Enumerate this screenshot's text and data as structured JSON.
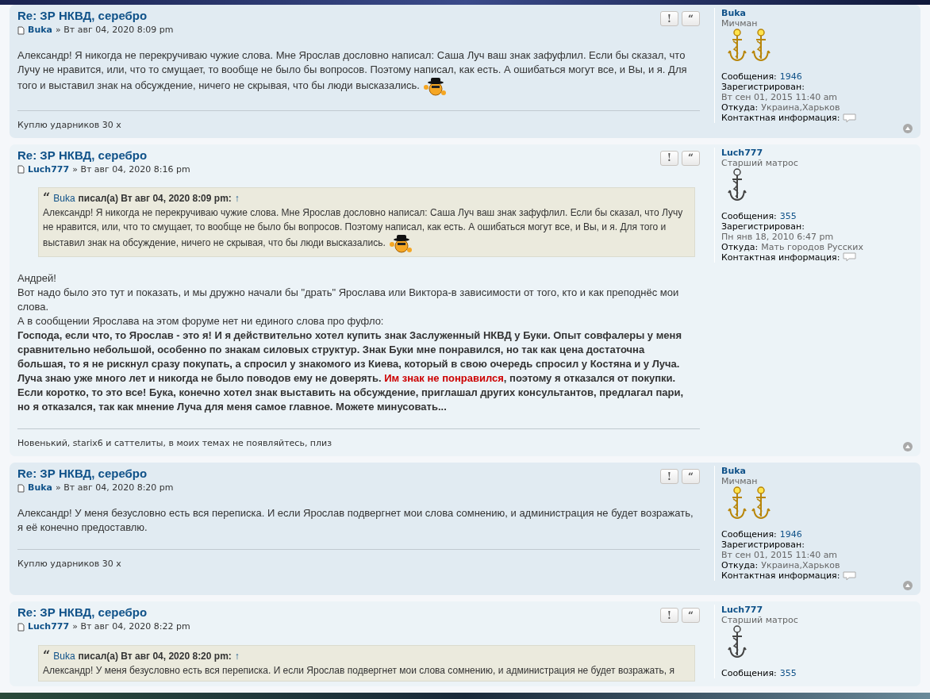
{
  "posts": [
    {
      "title": "Re: ЗР НКВД, серебро",
      "author": "Buka",
      "separator": "»",
      "date": "Вт авг 04, 2020 8:09 pm",
      "buttons": [
        "!",
        "“"
      ],
      "body": [
        {
          "kind": "text",
          "segments": [
            {
              "text": "Александр! Я никогда не перекручиваю чужие слова. Мне Ярослав дословно написал: Саша Луч ваш знак зафуфлил. Если бы сказал, что Лучу не нравится, или, что то смущает, то вообще не было бы вопросов. Поэтому написал, как есть. А ошибаться могут все, и Вы, и я. Для того и выставил знак на обсуждение, ничего не скрывая, что бы люди высказались.",
              "red": false
            }
          ],
          "smiley": true
        }
      ],
      "signature": "Куплю ударников 30 х",
      "profile": {
        "name": "Buka",
        "rank": "Мичман",
        "kind": "gold",
        "fields": [
          {
            "label": "Сообщения:",
            "value": "1946",
            "kind": "link"
          },
          {
            "label": "Зарегистрирован:",
            "value": "Вт сен 01, 2015 11:40 am",
            "kind": "plain"
          },
          {
            "label": "Откуда:",
            "value": "Украина,Харьков",
            "kind": "plain"
          },
          {
            "label": "Контактная информация:",
            "kind": "contact"
          }
        ]
      },
      "top_link": true
    },
    {
      "title": "Re: ЗР НКВД, серебро",
      "author": "Luch777",
      "separator": "»",
      "date": "Вт авг 04, 2020 8:16 pm",
      "buttons": [
        "!",
        "“"
      ],
      "quote": {
        "mark": "“",
        "author": "Buka",
        "meta": "писал(а) Вт авг 04, 2020 8:09 pm:",
        "arrow": "↑",
        "text": "Александр! Я никогда не перекручиваю чужие слова. Мне Ярослав дословно написал: Саша Луч ваш знак зафуфлил. Если бы сказал, что Лучу не нравится, или, что то смущает, то вообще не было бы вопросов. Поэтому написал, как есть. А ошибаться могут все, и Вы, и я. Для того и выставил знак на обсуждение, ничего не скрывая, что бы люди высказались.",
        "smiley": true
      },
      "body": [
        {
          "kind": "text",
          "segments": [
            {
              "text": "Андрей!",
              "red": false
            }
          ],
          "smiley": false
        },
        {
          "kind": "text",
          "segments": [
            {
              "text": "Вот надо было это тут и показать, и мы дружно начали бы \"драть\" Ярослава или Виктора-в зависимости от того, кто и как преподнёс мои слова.",
              "red": false
            }
          ],
          "smiley": false
        },
        {
          "kind": "text",
          "segments": [
            {
              "text": "А в сообщении Ярослава на этом форуме нет ни единого слова про фуфло:",
              "red": false
            }
          ],
          "smiley": false
        },
        {
          "kind": "bold",
          "segments": [
            {
              "text": "Господа, если что, то Ярослав - это я! И я действительно хотел купить знак Заслуженный НКВД у Буки. Опыт совфалеры у меня сравнительно небольшой, особенно по знакам силовых структур. Знак Буки мне понравился, но так как цена достаточна большая, то я не рискнул сразу покупать, а спросил у знакомого из Киева, который в свою очередь спросил у Костяна и у Луча. Луча знаю уже много лет и никогда не было поводов ему не доверять. ",
              "red": false
            },
            {
              "text": "Им знак не понравился",
              "red": true
            },
            {
              "text": ", поэтому я отказался от покупки. Если коротко, то это все! Бука, конечно хотел знак выставить на обсуждение, приглашал других консультантов, предлагал пари, но я отказался, так как мнение Луча для меня самое главное. Можете минусовать...",
              "red": false
            }
          ],
          "smiley": false
        }
      ],
      "signature": "Новенький, starix6 и саттелиты, в моих темах не появляйтесь, плиз",
      "profile": {
        "name": "Luch777",
        "rank": "Старший матрос",
        "kind": "grey",
        "fields": [
          {
            "label": "Сообщения:",
            "value": "355",
            "kind": "link"
          },
          {
            "label": "Зарегистрирован:",
            "value": "Пн янв 18, 2010 6:47 pm",
            "kind": "plain"
          },
          {
            "label": "Откуда:",
            "value": "Мать городов Русских",
            "kind": "plain"
          },
          {
            "label": "Контактная информация:",
            "kind": "contact"
          }
        ]
      },
      "top_link": true
    },
    {
      "title": "Re: ЗР НКВД, серебро",
      "author": "Buka",
      "separator": "»",
      "date": "Вт авг 04, 2020 8:20 pm",
      "buttons": [
        "!",
        "“"
      ],
      "body": [
        {
          "kind": "text",
          "segments": [
            {
              "text": "Александр! У меня безусловно есть вся переписка. И если Ярослав подвергнет мои слова сомнению, и администрация не будет возражать, я её конечно предоставлю.",
              "red": false
            }
          ],
          "smiley": false
        }
      ],
      "signature": "Куплю ударников 30 х",
      "profile": {
        "name": "Buka",
        "rank": "Мичман",
        "kind": "gold",
        "fields": [
          {
            "label": "Сообщения:",
            "value": "1946",
            "kind": "link"
          },
          {
            "label": "Зарегистрирован:",
            "value": "Вт сен 01, 2015 11:40 am",
            "kind": "plain"
          },
          {
            "label": "Откуда:",
            "value": "Украина,Харьков",
            "kind": "plain"
          },
          {
            "label": "Контактная информация:",
            "kind": "contact"
          }
        ]
      },
      "top_link": true
    },
    {
      "title": "Re: ЗР НКВД, серебро",
      "author": "Luch777",
      "separator": "»",
      "date": "Вт авг 04, 2020 8:22 pm",
      "buttons": [
        "!",
        "“"
      ],
      "quote": {
        "mark": "“",
        "author": "Buka",
        "meta": "писал(а) Вт авг 04, 2020 8:20 pm:",
        "arrow": "↑",
        "text": "Александр! У меня безусловно есть вся переписка. И если Ярослав подвергнет мои слова сомнению, и администрация не будет возражать, я",
        "smiley": false
      },
      "profile": {
        "name": "Luch777",
        "rank": "Старший матрос",
        "kind": "grey",
        "fields": [
          {
            "label": "Сообщения:",
            "value": "355",
            "kind": "link"
          }
        ]
      },
      "top_link": false
    }
  ]
}
